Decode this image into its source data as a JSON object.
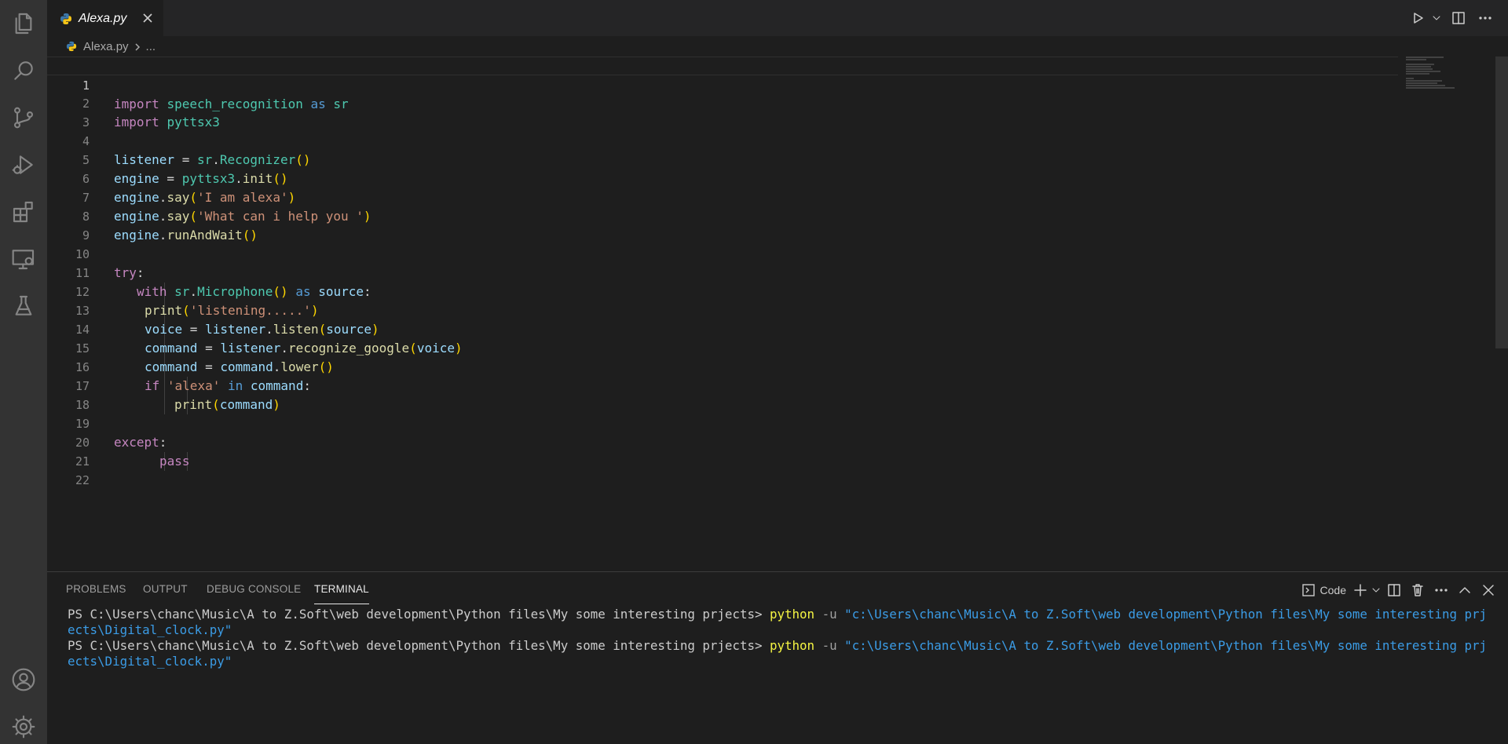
{
  "tabs": [
    {
      "label": "Alexa.py",
      "icon": "python-icon"
    }
  ],
  "editor_actions": [
    "run-icon",
    "chevron-down-icon",
    "split-editor-icon",
    "more-icon"
  ],
  "breadcrumb": {
    "file": "Alexa.py",
    "more": "..."
  },
  "activity_bar": [
    "explorer-icon",
    "search-icon",
    "source-control-icon",
    "run-debug-icon",
    "extensions-icon",
    "remote-explorer-icon",
    "testing-icon",
    "accounts-icon",
    "manage-gear-icon"
  ],
  "editor": {
    "current_line": 1,
    "lines": [
      {
        "n": "1"
      },
      {
        "n": "2"
      },
      {
        "n": "3"
      },
      {
        "n": "4"
      },
      {
        "n": "5"
      },
      {
        "n": "6"
      },
      {
        "n": "7"
      },
      {
        "n": "8"
      },
      {
        "n": "9"
      },
      {
        "n": "10"
      },
      {
        "n": "11"
      },
      {
        "n": "12"
      },
      {
        "n": "13"
      },
      {
        "n": "14"
      },
      {
        "n": "15"
      },
      {
        "n": "16"
      },
      {
        "n": "17"
      },
      {
        "n": "18"
      },
      {
        "n": "19"
      },
      {
        "n": "20"
      },
      {
        "n": "21"
      },
      {
        "n": "22"
      }
    ],
    "tokens": {
      "l1": [
        "import",
        "speech_recognition",
        "as",
        "sr"
      ],
      "l2": [
        "import",
        "pyttsx3"
      ],
      "l4": [
        "listener",
        " = ",
        "sr",
        ".",
        "Recognizer",
        "()"
      ],
      "l5": [
        "engine",
        " = ",
        "pyttsx3",
        ".",
        "init",
        "()"
      ],
      "l6": [
        "engine",
        ".",
        "say",
        "(",
        "'I am alexa'",
        ")"
      ],
      "l7": [
        "engine",
        ".",
        "say",
        "(",
        "'What can i help you '",
        ")"
      ],
      "l8": [
        "engine",
        ".",
        "runAndWait",
        "()"
      ],
      "l10": [
        "try",
        ":"
      ],
      "l11": [
        "with",
        "sr",
        ".",
        "Microphone",
        "()",
        "as",
        "source",
        ":"
      ],
      "l12": [
        "print",
        "(",
        "'listening.....'",
        ")"
      ],
      "l13": [
        "voice",
        " = ",
        "listener",
        ".",
        "listen",
        "(",
        "source",
        ")"
      ],
      "l14": [
        "command",
        " = ",
        "listener",
        ".",
        "recognize_google",
        "(",
        "voice",
        ")"
      ],
      "l15": [
        "command",
        " = ",
        "command",
        ".",
        "lower",
        "()"
      ],
      "l16": [
        "if",
        "'alexa'",
        "in",
        "command",
        ":"
      ],
      "l17": [
        "print",
        "(",
        "command",
        ")"
      ],
      "l19": [
        "except",
        ":"
      ],
      "l20": [
        "pass"
      ]
    }
  },
  "panel": {
    "tabs": [
      "PROBLEMS",
      "OUTPUT",
      "DEBUG CONSOLE",
      "TERMINAL"
    ],
    "active_tab": "TERMINAL",
    "terminal_profile": "Code",
    "terminal_lines": [
      {
        "prompt": "PS C:\\Users\\chanc\\Music\\A to Z.Soft\\web development\\Python files\\My some interesting prjects> ",
        "cmd": "python",
        "flag": " -u ",
        "path": "\"c:\\Users\\chanc\\Music\\A to Z.Soft\\web development\\Python files\\My some interesting prjects\\Digital_clock.py\""
      },
      {
        "prompt": "PS C:\\Users\\chanc\\Music\\A to Z.Soft\\web development\\Python files\\My some interesting prjects> ",
        "cmd": "python",
        "flag": " -u ",
        "path": "\"c:\\Users\\chanc\\Music\\A to Z.Soft\\web development\\Python files\\My some interesting prjects\\Digital_clock.py\""
      }
    ]
  },
  "colors": {
    "keyword": "#c586c0",
    "module": "#4ec9b0",
    "variable": "#9cdcfe",
    "function": "#dcdcaa",
    "string": "#ce9178",
    "bracket": "#ffd700"
  }
}
